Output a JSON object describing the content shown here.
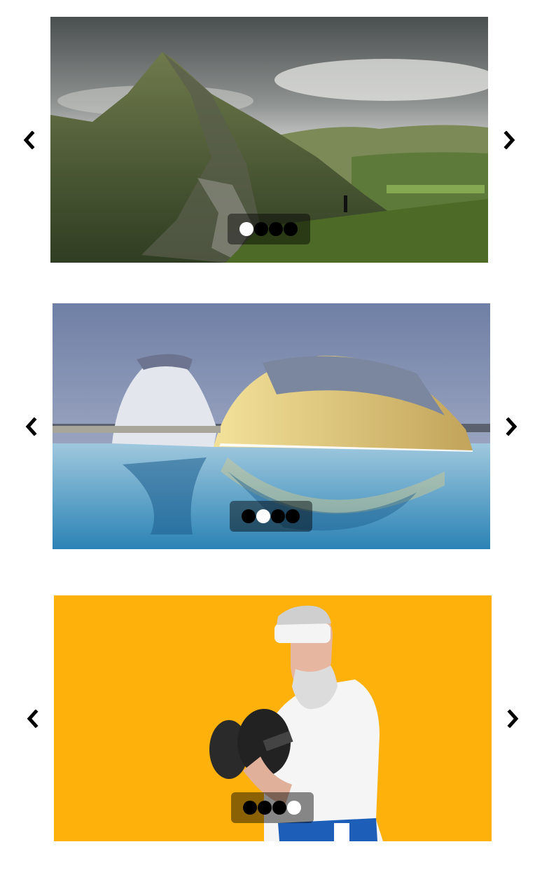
{
  "carousels": [
    {
      "scene": "mountain",
      "active_index": 0,
      "dot_count": 4,
      "prev_icon": "chevron-left-icon",
      "next_icon": "chevron-right-icon"
    },
    {
      "scene": "city-of-arts-and-sciences",
      "active_index": 1,
      "dot_count": 4,
      "prev_icon": "chevron-left-icon",
      "next_icon": "chevron-right-icon"
    },
    {
      "scene": "senior-athlete-dumbbell",
      "active_index": 3,
      "dot_count": 4,
      "prev_icon": "chevron-left-icon",
      "next_icon": "chevron-right-icon"
    }
  ],
  "colors": {
    "dot_inactive": "#000000",
    "dot_active": "#ffffff",
    "dot_bar": "rgba(0,0,0,0.45)",
    "arrow": "#000000",
    "athlete_background": "#fdb10a"
  }
}
